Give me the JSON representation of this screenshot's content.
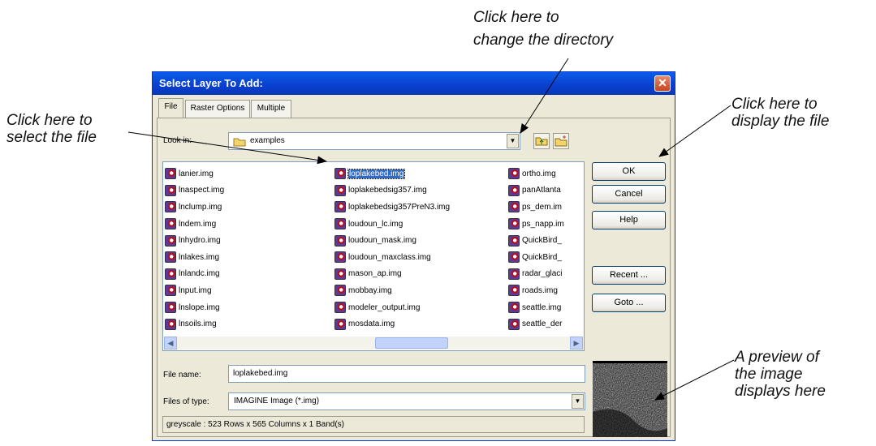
{
  "callouts": {
    "directory": [
      "Click here to",
      "change the directory"
    ],
    "select_file": [
      "Click here to",
      "select the file"
    ],
    "display_file": [
      "Click here to",
      "display the file"
    ],
    "preview": [
      "A preview of",
      "the image",
      "displays here"
    ]
  },
  "dialog": {
    "title": "Select Layer To Add:",
    "close_glyph": "✕",
    "tabs": [
      "File",
      "Raster Options",
      "Multiple"
    ],
    "look_in_label": "Look in:",
    "look_in_value": "examples",
    "files_col1": [
      "lanier.img",
      "lnaspect.img",
      "lnclump.img",
      "lndem.img",
      "lnhydro.img",
      "lnlakes.img",
      "lnlandc.img",
      "lnput.img",
      "lnslope.img",
      "lnsoils.img"
    ],
    "files_col2": [
      "loplakebed.img",
      "loplakebedsig357.img",
      "loplakebedsig357PreN3.img",
      "loudoun_lc.img",
      "loudoun_mask.img",
      "loudoun_maxclass.img",
      "mason_ap.img",
      "mobbay.img",
      "modeler_output.img",
      "mosdata.img"
    ],
    "files_col3": [
      "ortho.img",
      "panAtlanta",
      "ps_dem.im",
      "ps_napp.im",
      "QuickBird_",
      "QuickBird_",
      "radar_glaci",
      "roads.img",
      "seattle.img",
      "seattle_der"
    ],
    "selected_file": "loplakebed.img",
    "buttons": {
      "ok": "OK",
      "cancel": "Cancel",
      "help": "Help",
      "recent": "Recent ...",
      "goto": "Goto ..."
    },
    "file_name_label": "File name:",
    "file_name_value": "loplakebed.img",
    "files_of_type_label": "Files of type:",
    "files_of_type_value": "IMAGINE Image (*.img)",
    "status": "greyscale : 523 Rows x 565 Columns x 1 Band(s)"
  },
  "icons": [
    "folder-icon",
    "up-folder-icon",
    "new-folder-icon",
    "image-file-icon",
    "close-icon",
    "dropdown-arrow-icon",
    "scroll-left-icon",
    "scroll-right-icon"
  ],
  "colors": {
    "titlebar": "#0a4ad8",
    "selection": "#316ac5",
    "dialog_bg": "#ece9d8"
  }
}
